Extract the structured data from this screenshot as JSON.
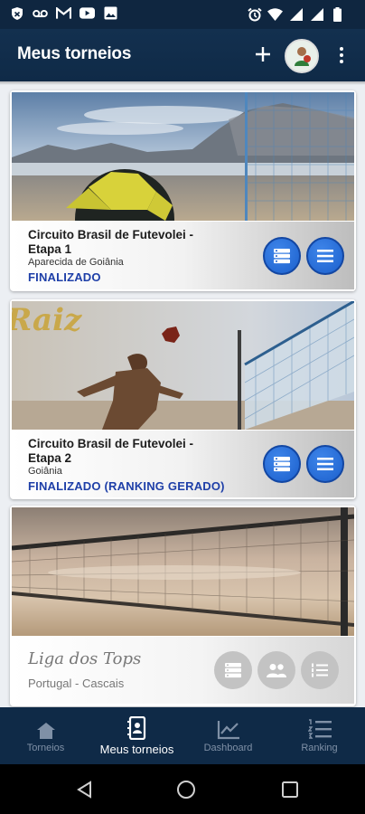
{
  "app": {
    "title": "Meus torneios"
  },
  "icons": {
    "status_left": [
      "shield-icon",
      "voicemail-icon",
      "gmail-icon",
      "youtube-icon",
      "image-icon"
    ],
    "status_right": [
      "alarm-icon",
      "wifi-icon",
      "signal-icon",
      "signal-icon",
      "battery-icon"
    ],
    "appbar": [
      "plus-icon",
      "avatar",
      "more-vert-icon"
    ]
  },
  "colors": {
    "primary": "#0f2a47",
    "accent_button": "#1b5fcc",
    "status_text": "#1e3fa8"
  },
  "tournaments": [
    {
      "name": "Circuito Brasil de Futevolei - Etapa 1",
      "city": "Aparecida de Goiânia",
      "status": "FINALIZADO",
      "buttons": [
        "list-icon",
        "menu-icon"
      ]
    },
    {
      "name": "Circuito Brasil de Futevolei - Etapa 2",
      "city": "Goiânia",
      "status": "FINALIZADO (RANKING GERADO)",
      "photo_text": "Raiz",
      "buttons": [
        "list-icon",
        "menu-icon"
      ]
    },
    {
      "name": "Liga dos Tops",
      "location": "Portugal -  Cascais",
      "buttons": [
        "list-icon",
        "people-icon",
        "numbered-list-icon"
      ]
    }
  ],
  "bottom_nav": [
    {
      "label": "Torneios",
      "icon": "trophy-icon",
      "active": false
    },
    {
      "label": "Meus torneios",
      "icon": "contacts-book-icon",
      "active": true
    },
    {
      "label": "Dashboard",
      "icon": "chart-icon",
      "active": false
    },
    {
      "label": "Ranking",
      "icon": "ranking-list-icon",
      "active": false
    }
  ]
}
